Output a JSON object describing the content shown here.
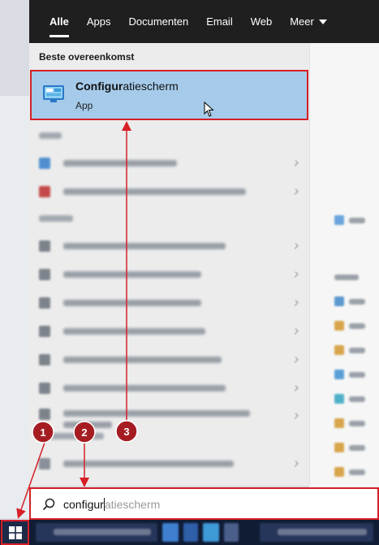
{
  "tabs": [
    {
      "label": "Alle",
      "active": true
    },
    {
      "label": "Apps"
    },
    {
      "label": "Documenten"
    },
    {
      "label": "Email"
    },
    {
      "label": "Web"
    },
    {
      "label": "Meer"
    }
  ],
  "best_match": {
    "section_label": "Beste overeenkomst",
    "title_bold": "Configur",
    "title_rest": "atiescherm",
    "subtitle": "App",
    "icon": "control-panel-icon"
  },
  "search": {
    "typed": "configur",
    "suggestion": "atiescherm",
    "icon": "search-icon"
  },
  "start_icon": "windows-logo-icon",
  "annotations": [
    "1",
    "2",
    "3"
  ],
  "colors": {
    "accent_red": "#d61f26",
    "annotation_fill": "#a51d22",
    "selection": "#a6cbea",
    "tabbar": "#1f1f1f",
    "taskbar": "#101c34"
  }
}
